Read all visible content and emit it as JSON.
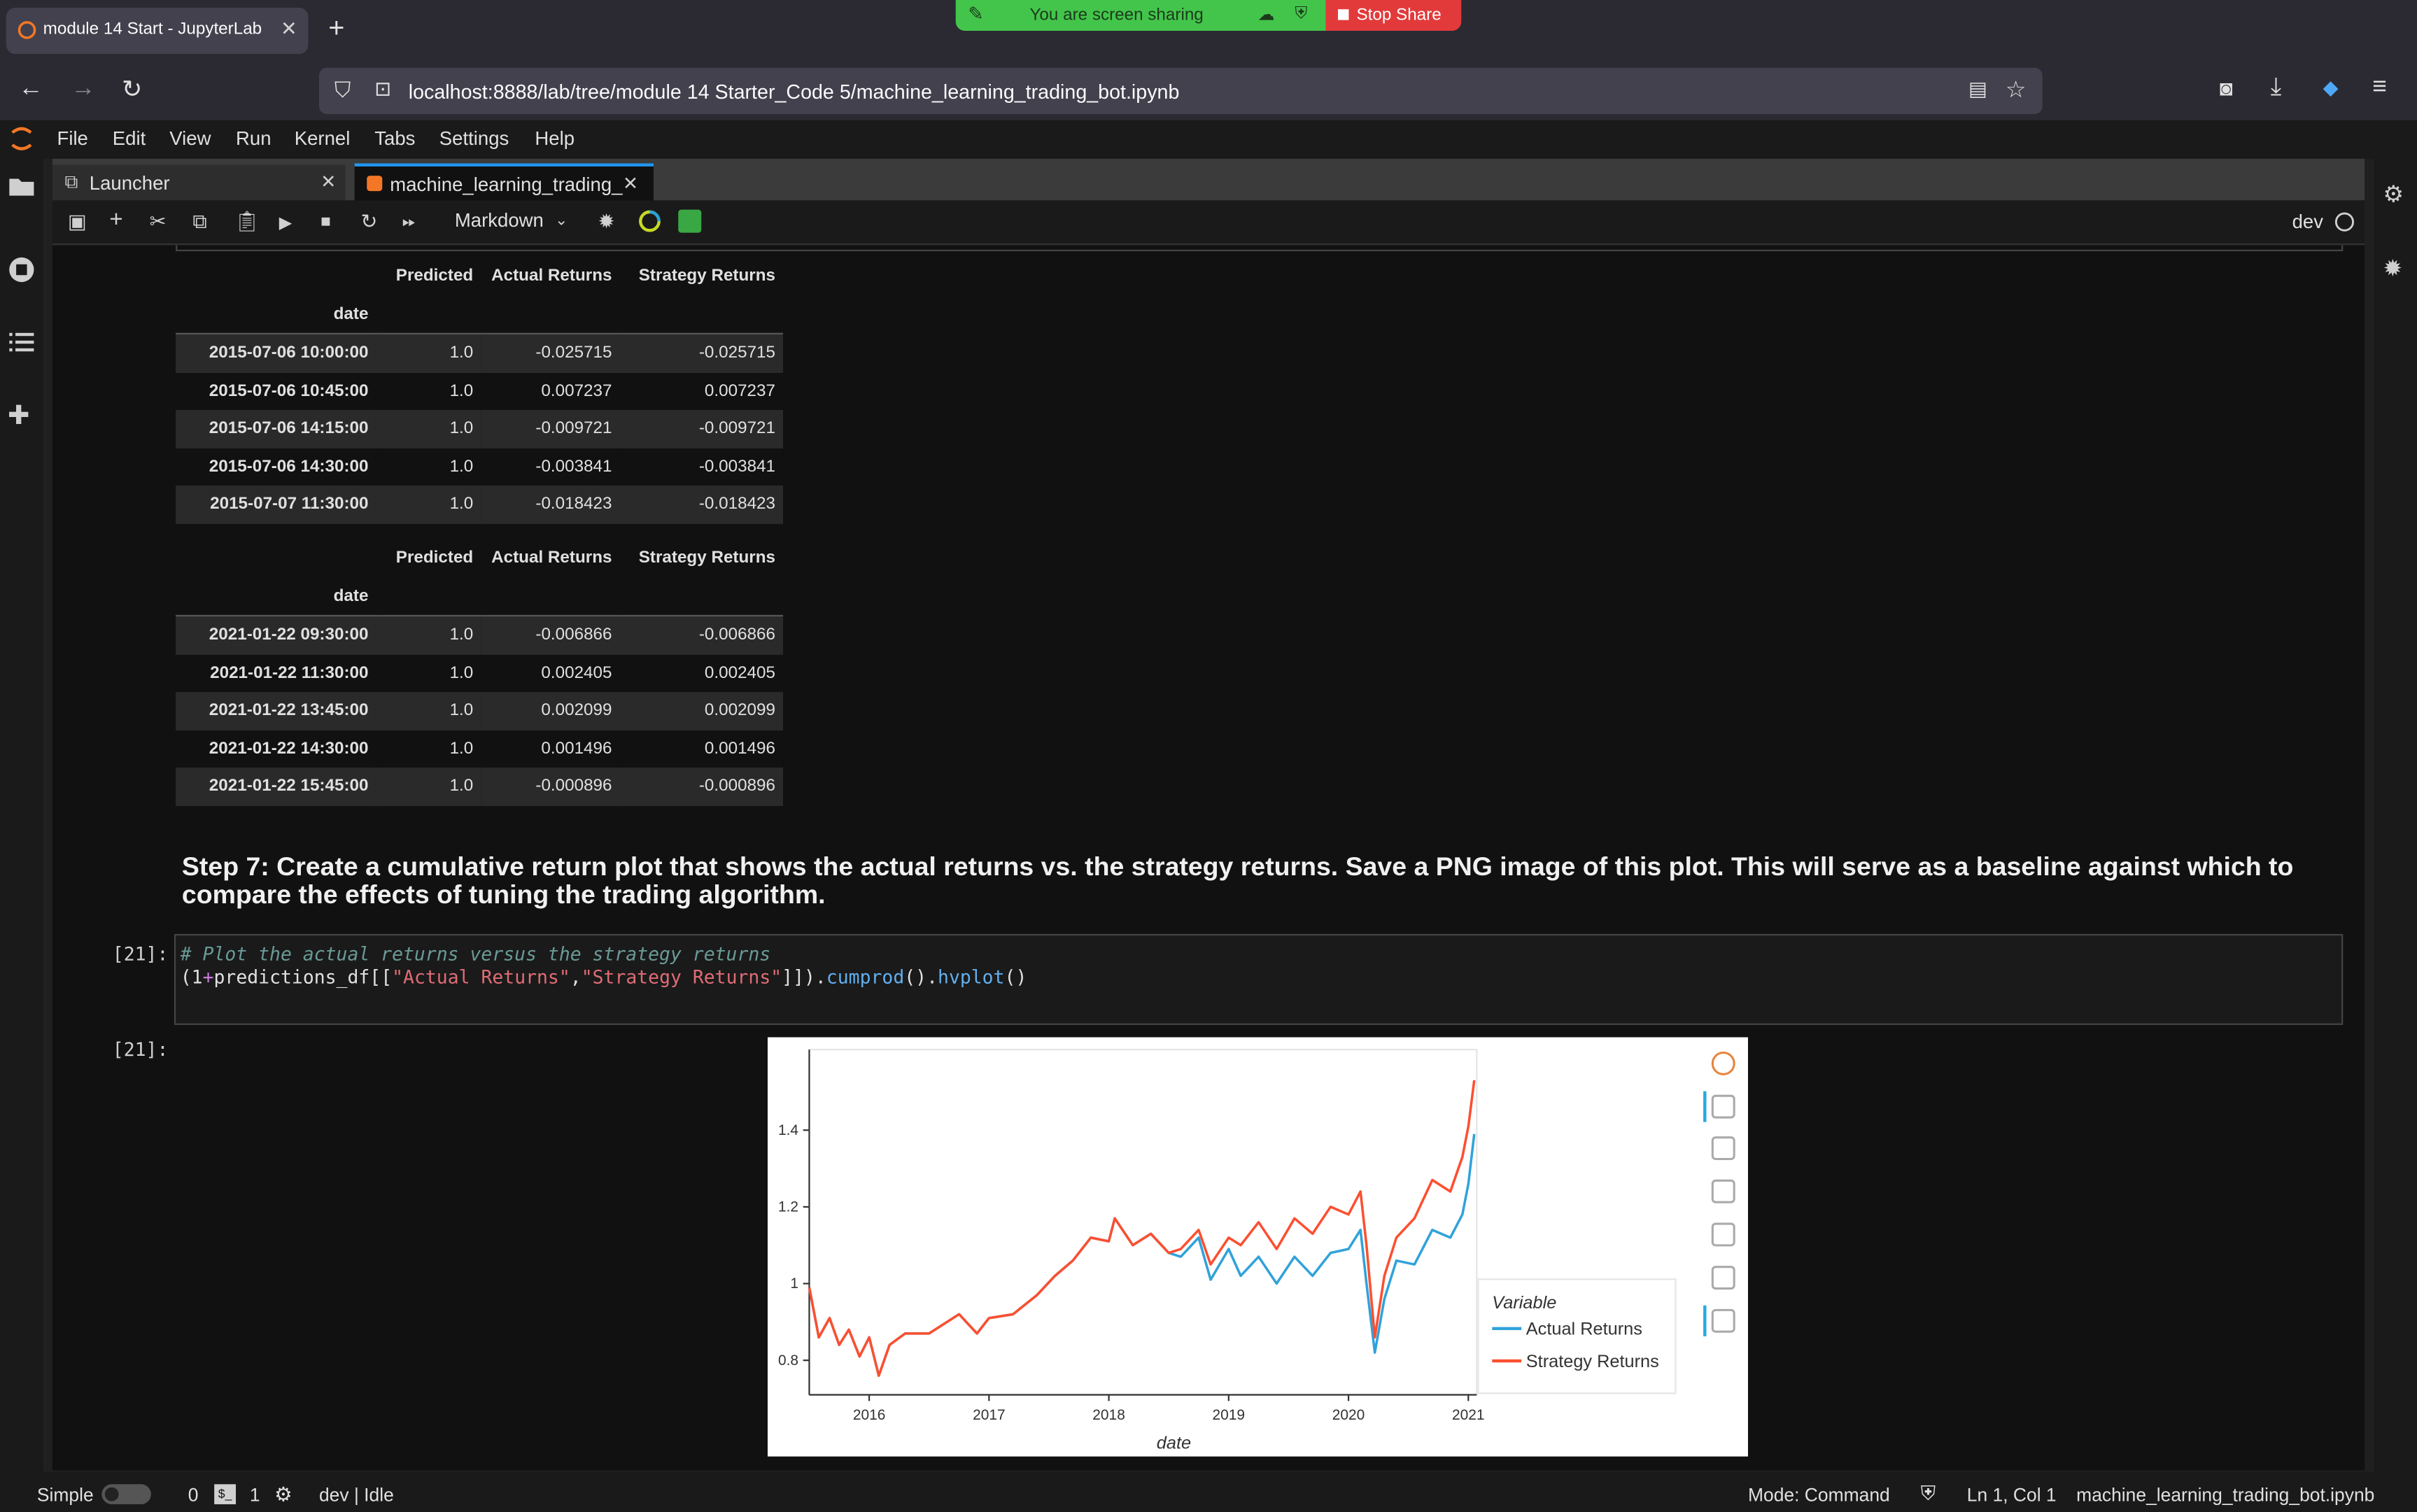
{
  "browser": {
    "tab_title": "module 14 Start - JupyterLab",
    "url": "localhost:8888/lab/tree/module 14 Starter_Code 5/machine_learning_trading_bot.ipynb",
    "screen_share_text": "You are screen sharing",
    "stop_share_label": "Stop Share"
  },
  "menu": [
    "File",
    "Edit",
    "View",
    "Run",
    "Kernel",
    "Tabs",
    "Settings",
    "Help"
  ],
  "doc_tabs": {
    "launcher": "Launcher",
    "notebook": "machine_learning_trading_"
  },
  "toolbar": {
    "cell_type": "Markdown",
    "kernel_name": "dev"
  },
  "tables": [
    {
      "columns": [
        "Predicted",
        "Actual Returns",
        "Strategy Returns"
      ],
      "index_name": "date",
      "rows": [
        [
          "2015-07-06 10:00:00",
          "1.0",
          "-0.025715",
          "-0.025715"
        ],
        [
          "2015-07-06 10:45:00",
          "1.0",
          "0.007237",
          "0.007237"
        ],
        [
          "2015-07-06 14:15:00",
          "1.0",
          "-0.009721",
          "-0.009721"
        ],
        [
          "2015-07-06 14:30:00",
          "1.0",
          "-0.003841",
          "-0.003841"
        ],
        [
          "2015-07-07 11:30:00",
          "1.0",
          "-0.018423",
          "-0.018423"
        ]
      ]
    },
    {
      "columns": [
        "Predicted",
        "Actual Returns",
        "Strategy Returns"
      ],
      "index_name": "date",
      "rows": [
        [
          "2021-01-22 09:30:00",
          "1.0",
          "-0.006866",
          "-0.006866"
        ],
        [
          "2021-01-22 11:30:00",
          "1.0",
          "0.002405",
          "0.002405"
        ],
        [
          "2021-01-22 13:45:00",
          "1.0",
          "0.002099",
          "0.002099"
        ],
        [
          "2021-01-22 14:30:00",
          "1.0",
          "0.001496",
          "0.001496"
        ],
        [
          "2021-01-22 15:45:00",
          "1.0",
          "-0.000896",
          "-0.000896"
        ]
      ]
    }
  ],
  "markdown_heading": "Step 7: Create a cumulative return plot that shows the actual returns vs. the strategy returns. Save a PNG image of this plot. This will serve as a baseline against which to compare the effects of tuning the trading algorithm.",
  "code_cell": {
    "prompt": "[21]:",
    "comment": "# Plot the actual returns versus the strategy returns",
    "line2_a": "(1",
    "line2_plus": "+",
    "line2_b": "predictions_df[[",
    "line2_s1": "\"Actual Returns\"",
    "line2_comma": ",",
    "line2_s2": "\"Strategy Returns\"",
    "line2_c": "]]).",
    "line2_f1": "cumprod",
    "line2_d": "().",
    "line2_f2": "hvplot",
    "line2_e": "()"
  },
  "output_prompt": "[21]:",
  "chart_data": {
    "type": "line",
    "xlabel": "date",
    "ylabel": "",
    "x_ticks": [
      "2016",
      "2017",
      "2018",
      "2019",
      "2020",
      "2021"
    ],
    "y_ticks": [
      "0.8",
      "1",
      "1.2",
      "1.4"
    ],
    "xlim": [
      2015.5,
      2021.07
    ],
    "ylim": [
      0.71,
      1.61
    ],
    "legend_title": "Variable",
    "legend_position": "bottom-right",
    "series": [
      {
        "name": "Actual Returns",
        "color": "#30a2da",
        "x": [
          2015.5,
          2015.58,
          2015.67,
          2015.75,
          2015.83,
          2015.92,
          2016.0,
          2016.08,
          2016.17,
          2016.3,
          2016.5,
          2016.6,
          2016.75,
          2016.9,
          2017.0,
          2017.2,
          2017.4,
          2017.55,
          2017.7,
          2017.85,
          2018.0,
          2018.05,
          2018.2,
          2018.35,
          2018.5,
          2018.6,
          2018.75,
          2018.85,
          2019.0,
          2019.1,
          2019.25,
          2019.4,
          2019.55,
          2019.7,
          2019.85,
          2020.0,
          2020.1,
          2020.15,
          2020.22,
          2020.3,
          2020.4,
          2020.55,
          2020.7,
          2020.85,
          2020.95,
          2021.0,
          2021.05
        ],
        "y": [
          0.99,
          0.86,
          0.91,
          0.84,
          0.88,
          0.81,
          0.86,
          0.76,
          0.84,
          0.87,
          0.87,
          0.89,
          0.92,
          0.87,
          0.91,
          0.92,
          0.97,
          1.02,
          1.06,
          1.12,
          1.11,
          1.17,
          1.1,
          1.13,
          1.08,
          1.07,
          1.12,
          1.01,
          1.09,
          1.02,
          1.07,
          1.0,
          1.07,
          1.02,
          1.08,
          1.09,
          1.14,
          1.0,
          0.82,
          0.96,
          1.06,
          1.05,
          1.14,
          1.12,
          1.18,
          1.26,
          1.39
        ]
      },
      {
        "name": "Strategy Returns",
        "color": "#fc4f30",
        "x": [
          2015.5,
          2015.58,
          2015.67,
          2015.75,
          2015.83,
          2015.92,
          2016.0,
          2016.08,
          2016.17,
          2016.3,
          2016.5,
          2016.6,
          2016.75,
          2016.9,
          2017.0,
          2017.2,
          2017.4,
          2017.55,
          2017.7,
          2017.85,
          2018.0,
          2018.05,
          2018.2,
          2018.35,
          2018.5,
          2018.6,
          2018.75,
          2018.85,
          2019.0,
          2019.1,
          2019.25,
          2019.4,
          2019.55,
          2019.7,
          2019.85,
          2020.0,
          2020.1,
          2020.15,
          2020.22,
          2020.3,
          2020.4,
          2020.55,
          2020.7,
          2020.85,
          2020.95,
          2021.0,
          2021.05
        ],
        "y": [
          0.99,
          0.86,
          0.91,
          0.84,
          0.88,
          0.81,
          0.86,
          0.76,
          0.84,
          0.87,
          0.87,
          0.89,
          0.92,
          0.87,
          0.91,
          0.92,
          0.97,
          1.02,
          1.06,
          1.12,
          1.11,
          1.17,
          1.1,
          1.13,
          1.08,
          1.09,
          1.14,
          1.05,
          1.12,
          1.1,
          1.16,
          1.09,
          1.17,
          1.13,
          1.2,
          1.18,
          1.24,
          1.1,
          0.86,
          1.02,
          1.12,
          1.17,
          1.27,
          1.24,
          1.33,
          1.41,
          1.53
        ]
      }
    ]
  },
  "statusbar": {
    "mode_simple": "Simple",
    "terminals": "0",
    "kernels": "1",
    "kernel_status": "dev | Idle",
    "mode": "Mode: Command",
    "position": "Ln 1, Col 1",
    "filename": "machine_learning_trading_bot.ipynb"
  }
}
